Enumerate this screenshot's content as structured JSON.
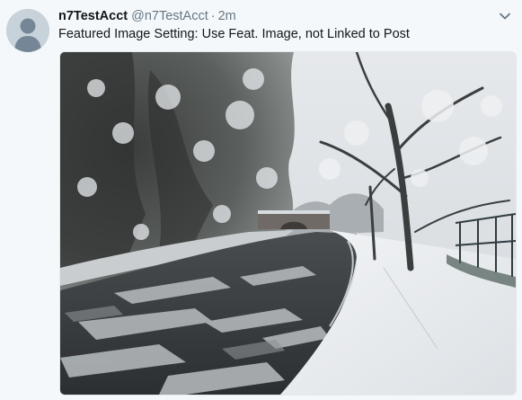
{
  "tweet": {
    "display_name": "n7TestAcct",
    "handle": "@n7TestAcct",
    "separator": "·",
    "timestamp": "2m",
    "text": "Featured Image Setting: Use Feat. Image, not Linked to Post"
  },
  "icons": {
    "avatar": "default-avatar-icon",
    "caret": "chevron-down-icon"
  },
  "colors": {
    "background": "#f5f8fa",
    "name": "#14171a",
    "secondary": "#657786",
    "avatar_bg": "#c8d2db"
  }
}
